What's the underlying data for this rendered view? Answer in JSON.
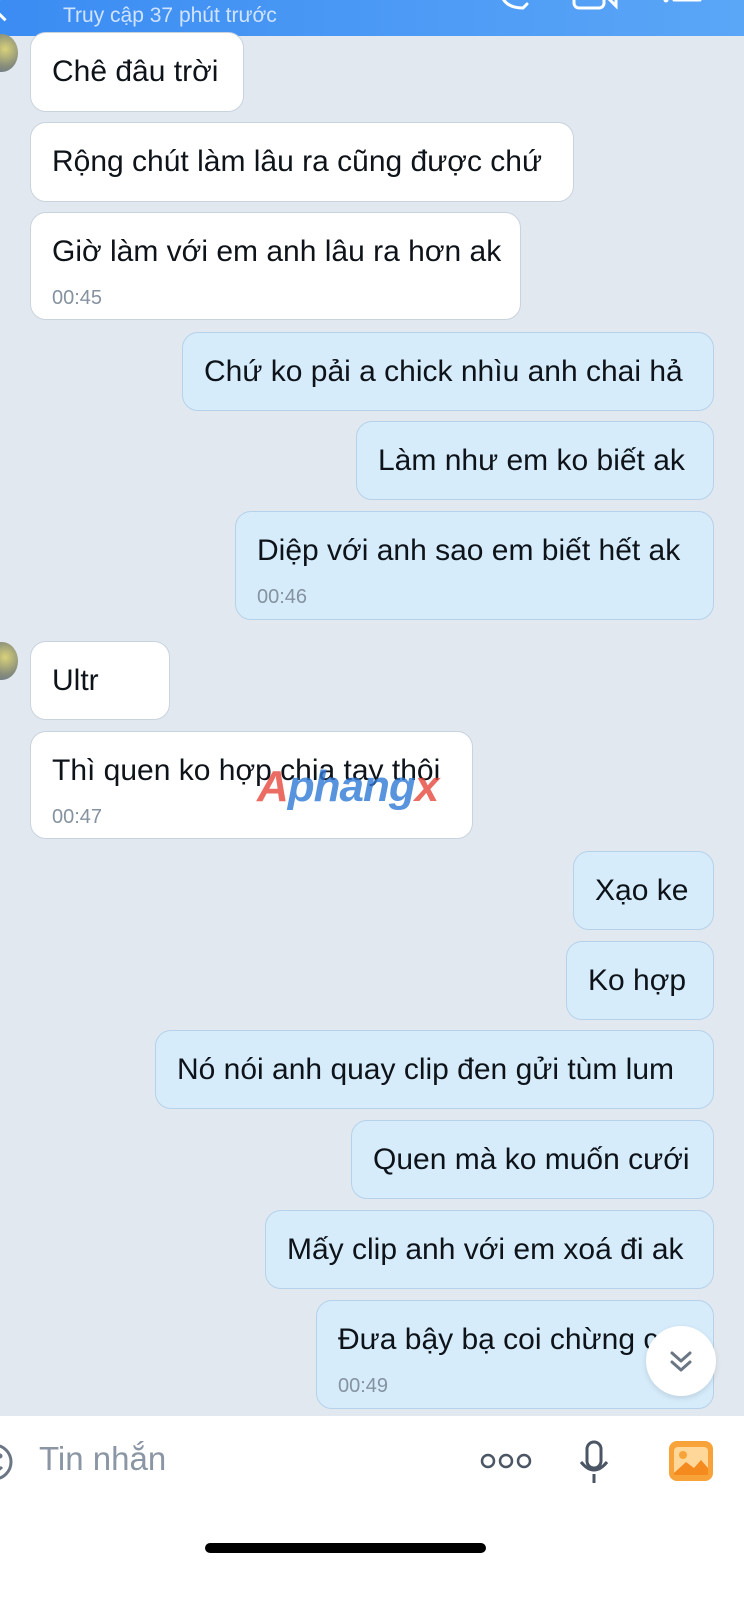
{
  "header": {
    "status": "Truy cập 37 phút trước"
  },
  "messages": [
    {
      "side": "in",
      "text": "Chê đâu trời"
    },
    {
      "side": "in",
      "text": "Rộng chút làm lâu ra cũng được chứ"
    },
    {
      "side": "in",
      "text": "Giờ làm với em anh lâu ra hơn ak",
      "time": "00:45"
    },
    {
      "side": "out",
      "text": "Chứ ko pải a chick nhìu anh chai hả"
    },
    {
      "side": "out",
      "text": "Làm như em ko biết ak"
    },
    {
      "side": "out",
      "text": "Diệp với anh sao em biết hết ak",
      "time": "00:46"
    },
    {
      "side": "in",
      "text": "Ultr"
    },
    {
      "side": "in",
      "text": "Thì quen ko hợp chia tay thôi",
      "time": "00:47"
    },
    {
      "side": "out",
      "text": "Xạo ke"
    },
    {
      "side": "out",
      "text": "Ko hợp"
    },
    {
      "side": "out",
      "text": "Nó nói anh quay clip đen gửi tùm lum"
    },
    {
      "side": "out",
      "text": "Quen mà ko muốn cưới"
    },
    {
      "side": "out",
      "text": "Mấy clip anh với em xoá đi ak"
    },
    {
      "side": "out",
      "text": "Đưa bậy bạ coi chừng c",
      "time": "00:49"
    }
  ],
  "watermark": {
    "part1": "A",
    "part2": "phang",
    "part3": "x"
  },
  "input": {
    "placeholder": "Tin nhắn",
    "icons": [
      "emoji-icon",
      "more-icon",
      "microphone-icon",
      "image-icon"
    ]
  },
  "scroll_button": {
    "icon": "chevron-double-down-icon"
  },
  "header_icons": [
    "back-icon",
    "phone-icon",
    "video-call-icon",
    "menu-icon"
  ]
}
